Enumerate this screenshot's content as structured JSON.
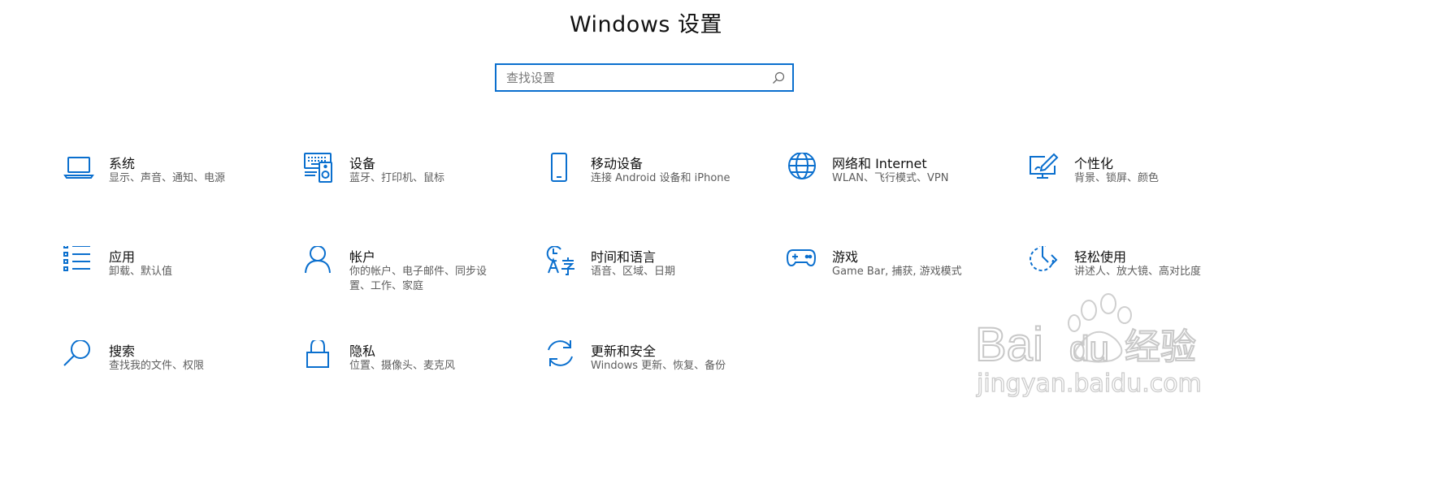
{
  "window": {
    "title": "Windows 设置"
  },
  "search": {
    "placeholder": "查找设置",
    "icon": "search-icon"
  },
  "accent_color": "#0a6fce",
  "categories": [
    {
      "name": "系统",
      "desc": "显示、声音、通知、电源",
      "icon": "laptop-icon"
    },
    {
      "name": "设备",
      "desc": "蓝牙、打印机、鼠标",
      "icon": "keyboard-speaker-icon"
    },
    {
      "name": "移动设备",
      "desc": "连接 Android 设备和 iPhone",
      "icon": "phone-icon"
    },
    {
      "name": "网络和 Internet",
      "desc": "WLAN、飞行模式、VPN",
      "icon": "globe-icon"
    },
    {
      "name": "个性化",
      "desc": "背景、锁屏、颜色",
      "icon": "paintbrush-monitor-icon"
    },
    {
      "name": "应用",
      "desc": "卸载、默认值",
      "icon": "app-list-icon"
    },
    {
      "name": "帐户",
      "desc": "你的帐户、电子邮件、同步设置、工作、家庭",
      "icon": "person-icon"
    },
    {
      "name": "时间和语言",
      "desc": "语音、区域、日期",
      "icon": "clock-language-icon"
    },
    {
      "name": "游戏",
      "desc": "Game Bar, 捕获, 游戏模式",
      "icon": "gamepad-icon"
    },
    {
      "name": "轻松使用",
      "desc": "讲述人、放大镜、高对比度",
      "icon": "ease-of-access-icon"
    },
    {
      "name": "搜索",
      "desc": "查找我的文件、权限",
      "icon": "search-magnifier-icon"
    },
    {
      "name": "隐私",
      "desc": "位置、摄像头、麦克风",
      "icon": "lock-icon"
    },
    {
      "name": "更新和安全",
      "desc": "Windows 更新、恢复、备份",
      "icon": "sync-arrows-icon"
    }
  ],
  "watermark": {
    "brand": "Baidu经验",
    "url": "jingyan.baidu.com"
  }
}
